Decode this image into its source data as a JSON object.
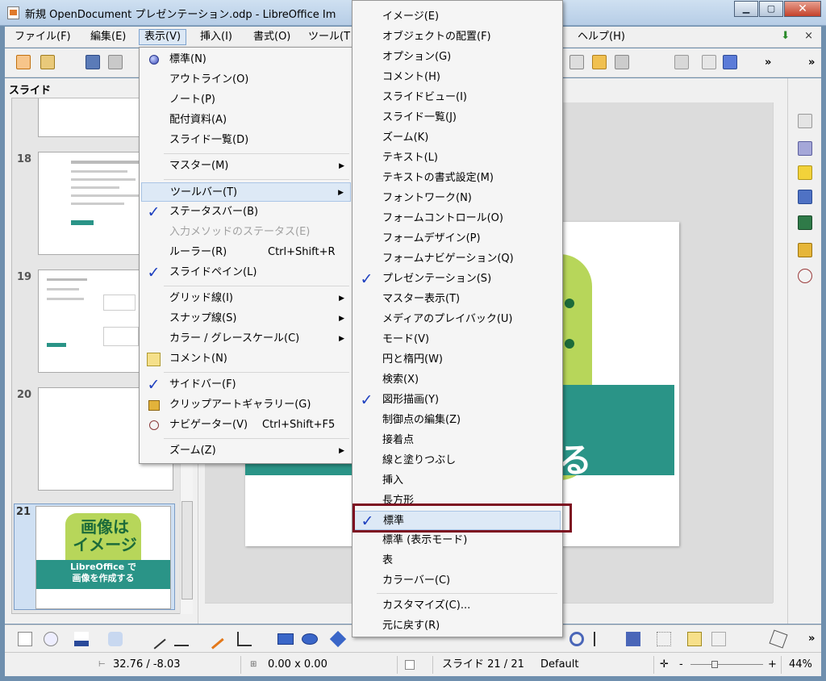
{
  "window": {
    "title": "新規 OpenDocument プレゼンテーション.odp - LibreOffice Im",
    "minimize": "▁",
    "maximize": "▢",
    "close": "✕"
  },
  "menubar": {
    "items": [
      "ファイル(F)",
      "編集(E)",
      "表示(V)",
      "挿入(I)",
      "書式(O)",
      "ツール(T",
      "ヘルプ(H)"
    ],
    "close_doc": "×",
    "more": "»"
  },
  "slide_pane": {
    "header": "スライド",
    "slides": [
      {
        "number": "18"
      },
      {
        "number": "19"
      },
      {
        "number": "20"
      },
      {
        "number": "21",
        "title_text": "画像は\nイメージ",
        "caption": "LibreOffice で\n画像を作成する"
      }
    ]
  },
  "view_menu": {
    "items": [
      {
        "label": "標準(N)",
        "icon": "radio-selected"
      },
      {
        "label": "アウトライン(O)"
      },
      {
        "label": "ノート(P)"
      },
      {
        "label": "配付資料(A)"
      },
      {
        "label": "スライド一覧(D)"
      },
      {
        "label": "マスター(M)",
        "submenu": true
      },
      {
        "label": "ツールバー(T)",
        "submenu": true,
        "highlighted": true
      },
      {
        "label": "ステータスバー(B)",
        "checked": true
      },
      {
        "label": "入力メソッドのステータス(E)",
        "disabled": true
      },
      {
        "label": "ルーラー(R)",
        "shortcut": "Ctrl+Shift+R"
      },
      {
        "label": "スライドペイン(L)",
        "checked": true
      },
      {
        "label": "グリッド線(I)",
        "submenu": true
      },
      {
        "label": "スナップ線(S)",
        "submenu": true
      },
      {
        "label": "カラー / グレースケール(C)",
        "submenu": true
      },
      {
        "label": "コメント(N)",
        "icon": "comment-icon"
      },
      {
        "label": "サイドバー(F)",
        "checked": true
      },
      {
        "label": "クリップアートギャラリー(G)",
        "icon": "gallery-icon"
      },
      {
        "label": "ナビゲーター(V)",
        "shortcut": "Ctrl+Shift+F5",
        "icon": "navigator-icon"
      },
      {
        "label": "ズーム(Z)",
        "submenu": true
      }
    ]
  },
  "toolbars_submenu": {
    "items": [
      {
        "label": "イメージ(E)"
      },
      {
        "label": "オブジェクトの配置(F)"
      },
      {
        "label": "オプション(G)"
      },
      {
        "label": "コメント(H)"
      },
      {
        "label": "スライドビュー(I)"
      },
      {
        "label": "スライド一覧(J)"
      },
      {
        "label": "ズーム(K)"
      },
      {
        "label": "テキスト(L)"
      },
      {
        "label": "テキストの書式設定(M)"
      },
      {
        "label": "フォントワーク(N)"
      },
      {
        "label": "フォームコントロール(O)"
      },
      {
        "label": "フォームデザイン(P)"
      },
      {
        "label": "フォームナビゲーション(Q)"
      },
      {
        "label": "プレゼンテーション(S)",
        "checked": true
      },
      {
        "label": "マスター表示(T)"
      },
      {
        "label": "メディアのプレイバック(U)"
      },
      {
        "label": "モード(V)"
      },
      {
        "label": "円と楕円(W)"
      },
      {
        "label": "検索(X)"
      },
      {
        "label": "図形描画(Y)",
        "checked": true
      },
      {
        "label": "制御点の編集(Z)"
      },
      {
        "label": "接着点"
      },
      {
        "label": "線と塗りつぶし"
      },
      {
        "label": "挿入"
      },
      {
        "label": "長方形"
      },
      {
        "label": "標準",
        "checked": true,
        "highlighted": true
      },
      {
        "label": "標準 (表示モード)"
      },
      {
        "label": "表"
      },
      {
        "label": "カラーバー(C)"
      },
      {
        "label": "カスタマイズ(C)..."
      },
      {
        "label": "元に戻す(R)"
      }
    ]
  },
  "slide_content": {
    "caption_part": "る"
  },
  "statusbar": {
    "position": "32.76 / -8.03",
    "size": "0.00 x 0.00",
    "slide": "スライド 21 / 21",
    "layout": "Default",
    "zoom_minus": "-",
    "zoom_plus": "+",
    "zoom": "44%",
    "zoom_level": 0.44
  },
  "colors": {
    "slide_accent_green": "#b7d65a",
    "slide_teal": "#2a9487",
    "check_blue": "#1d3fbf",
    "focus_border": "#7d1020"
  }
}
